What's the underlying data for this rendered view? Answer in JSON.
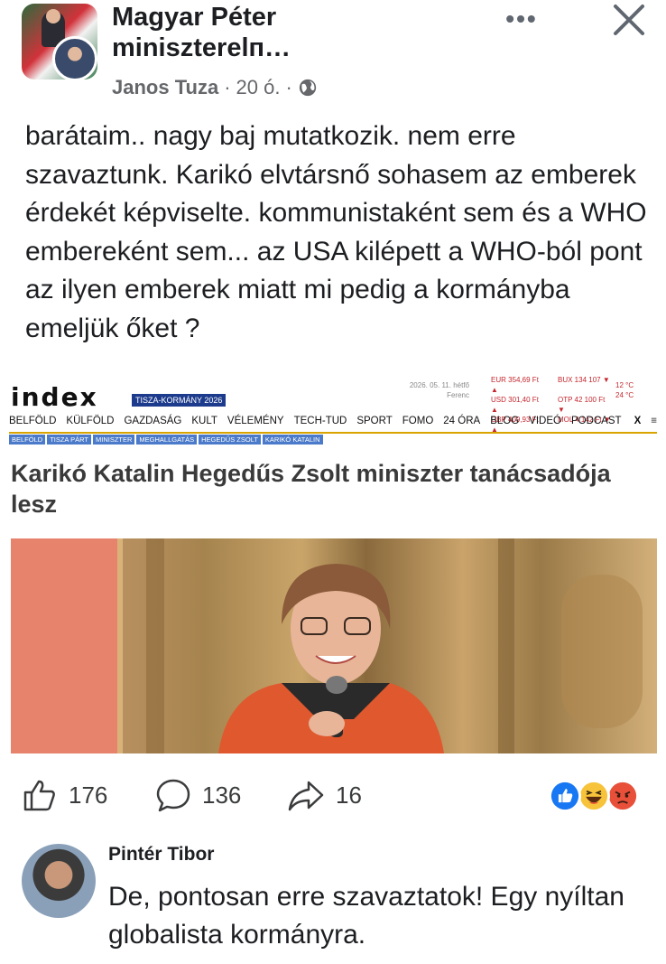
{
  "post": {
    "page_name": "Magyar Péter miniszterelni…",
    "page_name_line1": "Magyar Péter",
    "page_name_line2": "miniszterelп…",
    "author": "Janos Tuza",
    "time": "20 ó.",
    "separator": "·",
    "more_label": "•••",
    "text": "barátaim.. nagy baj mutatkozik. nem erre szavaztunk. Karikó elvtársnő sohasem az emberek érdekét képviselte. kommunistaként sem és a WHO embereként sem... az USA kilépett a WHO-ból pont az ilyen emberek miatt mi pedig a kormányba emeljük őket ?"
  },
  "article": {
    "site": "index",
    "badge": "TISZA-KORMÁNY 2026",
    "date_line1": "2026. 05. 11. hétfő",
    "date_line2": "Ferenc",
    "rates": [
      [
        "EUR 354,69 Ft ▲",
        "BUX 134 107 ▼"
      ],
      [
        "USD 301,40 Ft ▲",
        "OTP 42 100 Ft ▼"
      ],
      [
        "GBP 409,93 Ft ▲",
        "MOL 4 142 Ft ▼"
      ]
    ],
    "weather_line1": "12 °C",
    "weather_line2": "24 °C",
    "nav": [
      "BELFÖLD",
      "KÜLFÖLD",
      "GAZDASÁG",
      "KULT",
      "VÉLEMÉNY",
      "TECH-TUD",
      "SPORT",
      "FOMO",
      "24 ÓRA",
      "BLOG",
      "VIDEÓ",
      "PODCAST"
    ],
    "nav_close": "X",
    "nav_menu": "≡",
    "tags": [
      "BELFÖLD",
      "TISZA PÁRT",
      "MINISZTER",
      "MEGHALLGATÁS",
      "HEGEDŰS ZSOLT",
      "KARIKÓ KATALIN"
    ],
    "headline": "Karikó Katalin Hegedűs Zsolt miniszter tanácsadója lesz"
  },
  "stats": {
    "likes": "176",
    "comments": "136",
    "shares": "16"
  },
  "colors": {
    "like_blue": "#1877f2",
    "haha_yellow": "#f7c33a",
    "angry_red": "#e8503a",
    "index_badge": "#1d3b8c",
    "index_tag": "#4a7ac9"
  },
  "comment": {
    "name": "Pintér Tibor",
    "text": "De, pontosan erre szavaztatok! Egy nyíltan globalista kormányra."
  }
}
